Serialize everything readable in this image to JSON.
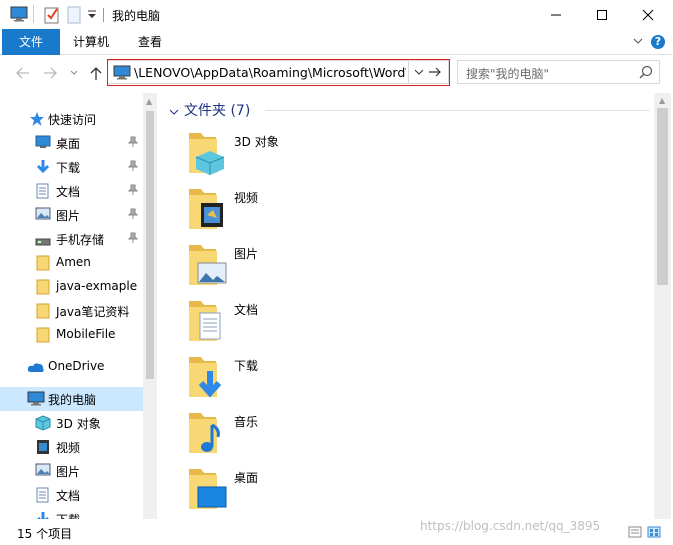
{
  "window": {
    "title": "我的电脑",
    "minimize_label": "",
    "maximize_label": "",
    "close_label": ""
  },
  "ribbon": {
    "tabs": [
      {
        "label": "文件"
      },
      {
        "label": "计算机"
      },
      {
        "label": "查看"
      }
    ],
    "help_label": "?"
  },
  "address": {
    "path": "\\LENOVO\\AppData\\Roaming\\Microsoft\\Word\\",
    "search_placeholder": "搜索\"我的电脑\""
  },
  "sidebar": {
    "quick_access": "快速访问",
    "items": [
      {
        "label": "桌面",
        "icon": "desktop-icon",
        "pinned": true
      },
      {
        "label": "下载",
        "icon": "download-icon",
        "pinned": true
      },
      {
        "label": "文档",
        "icon": "document-icon",
        "pinned": true
      },
      {
        "label": "图片",
        "icon": "picture-icon",
        "pinned": true
      },
      {
        "label": "手机存储",
        "icon": "drive-icon",
        "pinned": true
      },
      {
        "label": "Amen",
        "icon": "folder-icon",
        "pinned": false
      },
      {
        "label": "java-exmaple",
        "icon": "folder-icon",
        "pinned": false
      },
      {
        "label": "Java笔记资料",
        "icon": "folder-icon",
        "pinned": false
      },
      {
        "label": "MobileFile",
        "icon": "folder-icon",
        "pinned": false
      }
    ],
    "onedrive": "OneDrive",
    "this_pc": "我的电脑",
    "pc_items": [
      {
        "label": "3D 对象",
        "icon": "3d-objects-icon"
      },
      {
        "label": "视频",
        "icon": "video-icon"
      },
      {
        "label": "图片",
        "icon": "picture-icon"
      },
      {
        "label": "文档",
        "icon": "document-icon"
      },
      {
        "label": "下载",
        "icon": "download-icon"
      }
    ]
  },
  "content": {
    "group_title": "文件夹 (7)",
    "folders": [
      {
        "label": "3D 对象",
        "icon": "3d-objects-folder-icon"
      },
      {
        "label": "视频",
        "icon": "video-folder-icon"
      },
      {
        "label": "图片",
        "icon": "picture-folder-icon"
      },
      {
        "label": "文档",
        "icon": "document-folder-icon"
      },
      {
        "label": "下载",
        "icon": "download-folder-icon"
      },
      {
        "label": "音乐",
        "icon": "music-folder-icon"
      },
      {
        "label": "桌面",
        "icon": "desktop-folder-icon"
      }
    ]
  },
  "status": {
    "count": "15 个项目",
    "watermark": "https://blog.csdn.net/qq_3895"
  },
  "colors": {
    "accent": "#1979ca",
    "highlight": "#e02020",
    "selected": "#cce8ff",
    "folder": "#f8d775"
  }
}
